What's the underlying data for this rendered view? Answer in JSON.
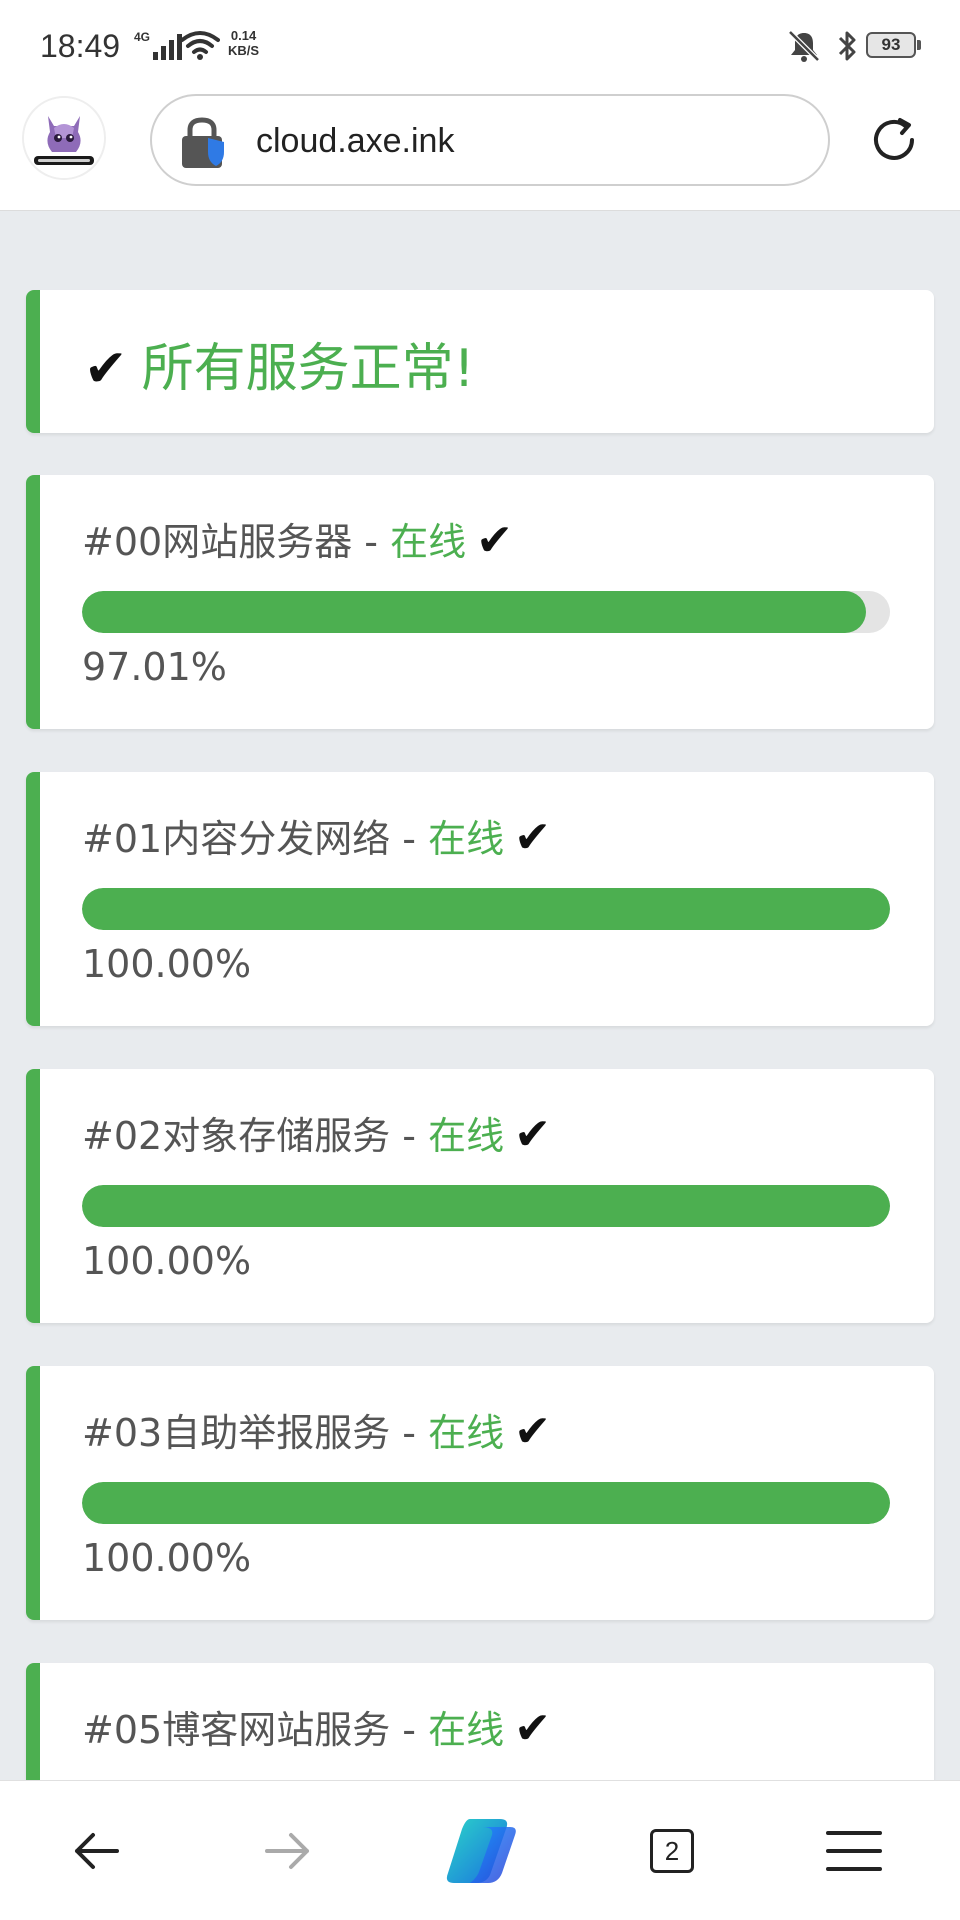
{
  "status_bar": {
    "time": "18:49",
    "network": "4G",
    "speed_value": "0.14",
    "speed_unit": "KB/S",
    "battery": "93"
  },
  "browser": {
    "url": "cloud.axe.ink",
    "tab_count": "2"
  },
  "summary": {
    "check": "✔",
    "message": "所有服务正常!"
  },
  "services": [
    {
      "name": "#00网站服务器 - ",
      "status": "在线",
      "check": "✔",
      "percent": "97.01%",
      "uptime": 97.01
    },
    {
      "name": "#01内容分发网络 - ",
      "status": "在线",
      "check": "✔",
      "percent": "100.00%",
      "uptime": 100
    },
    {
      "name": "#02对象存储服务 - ",
      "status": "在线",
      "check": "✔",
      "percent": "100.00%",
      "uptime": 100
    },
    {
      "name": "#03自助举报服务 - ",
      "status": "在线",
      "check": "✔",
      "percent": "100.00%",
      "uptime": 100
    },
    {
      "name": "#05博客网站服务 - ",
      "status": "在线",
      "check": "✔",
      "percent": "",
      "uptime": null
    }
  ],
  "colors": {
    "accent_green": "#4caf50",
    "page_background": "#e8ebee",
    "track": "#e4e4e4"
  },
  "icons": {
    "back": "arrow-left-icon",
    "forward": "arrow-right-icon",
    "copilot": "copilot-icon",
    "menu": "menu-icon",
    "reload": "reload-icon",
    "lock": "lock-shield-icon"
  }
}
